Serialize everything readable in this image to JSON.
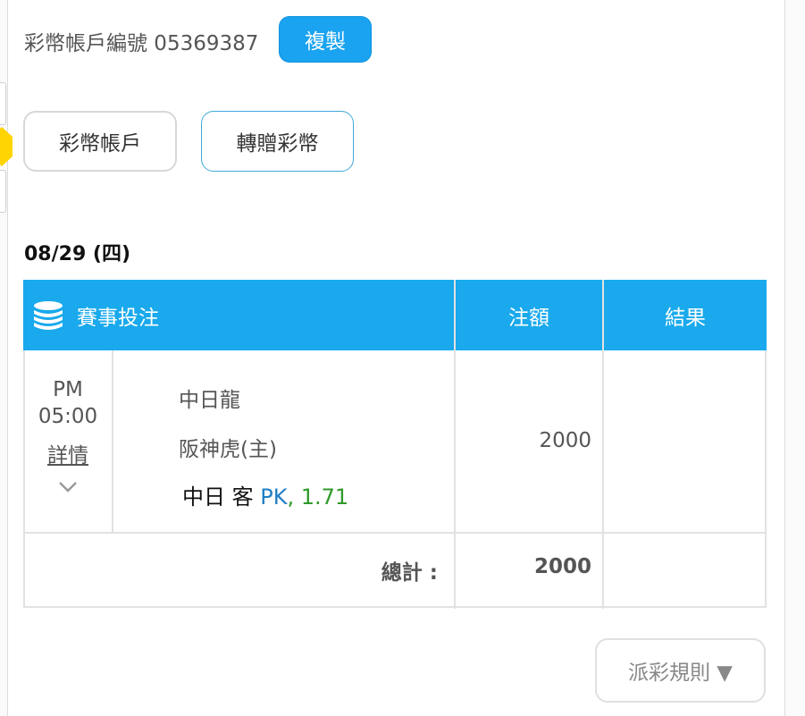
{
  "account": {
    "label": "彩幣帳戶編號 05369387",
    "copy_button": "複製"
  },
  "buttons": {
    "coin_account": "彩幣帳戶",
    "transfer_coins": "轉贈彩幣"
  },
  "date_heading": "08/29 (四)",
  "table": {
    "headers": {
      "events": "賽事投注",
      "amount": "注額",
      "result": "結果"
    },
    "rows": [
      {
        "time_period": "PM",
        "time_clock": "05:00",
        "detail_link": "詳情",
        "team_away": "中日龍",
        "team_home": "阪神虎(主)",
        "pick_text": "中日 客",
        "pick_line": "PK",
        "pick_odds": ", 1.71",
        "amount": "2000",
        "result": ""
      }
    ],
    "total_label": "總計 :",
    "total_amount": "2000"
  },
  "rules_button": "派彩規則 ▼",
  "colors": {
    "accent": "#19a9ec",
    "line_text": "#1f7fc4",
    "odds_text": "#2f9a2a",
    "border": "#e2e2e2"
  },
  "icons": {
    "header_icon": "coin-stack-icon",
    "detail_toggle": "chevron-down-icon"
  }
}
